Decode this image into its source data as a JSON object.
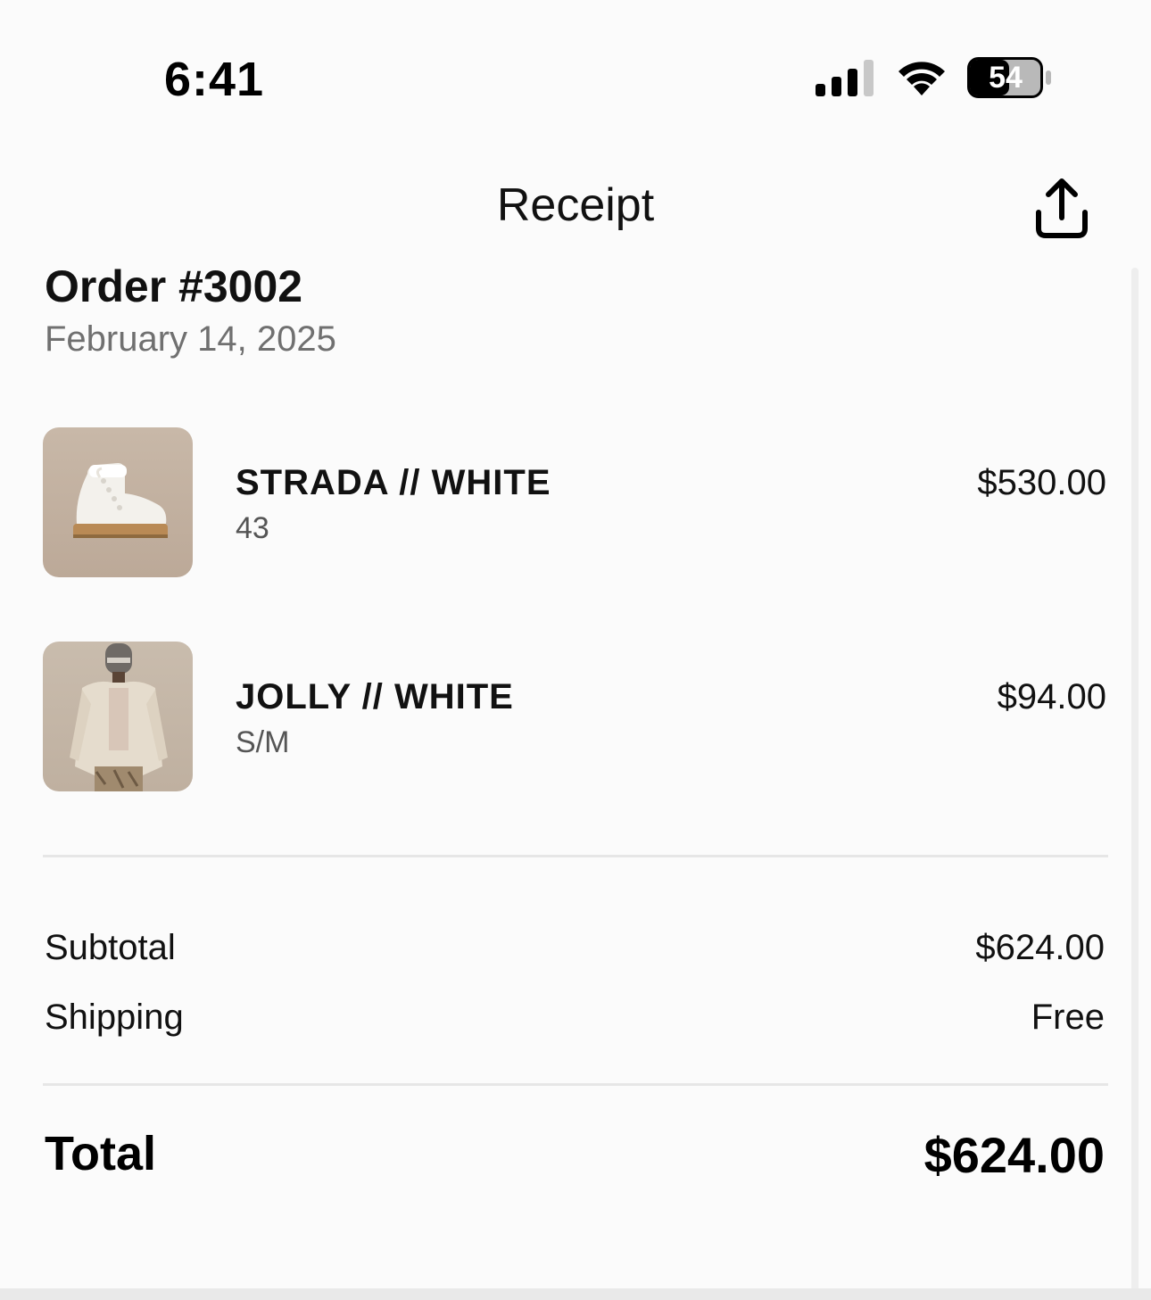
{
  "status_bar": {
    "time": "6:41",
    "battery": "54",
    "icons": [
      "signal-icon",
      "wifi-icon",
      "battery-icon"
    ]
  },
  "nav": {
    "title": "Receipt",
    "share_icon": "share-icon"
  },
  "order": {
    "title": "Order #3002",
    "date": "February 14, 2025"
  },
  "items": [
    {
      "name": "STRADA // WHITE",
      "variant": "43",
      "price": "$530.00",
      "image": "white-boot-image"
    },
    {
      "name": "JOLLY // WHITE",
      "variant": "S/M",
      "price": "$94.00",
      "image": "model-jacket-image"
    }
  ],
  "summary": {
    "subtotal_label": "Subtotal",
    "subtotal_value": "$624.00",
    "shipping_label": "Shipping",
    "shipping_value": "Free",
    "total_label": "Total",
    "total_value": "$624.00"
  },
  "colors": {
    "background": "#fbfbfb",
    "text_primary": "#111111",
    "text_secondary": "#707070",
    "divider": "#e6e6e6"
  }
}
